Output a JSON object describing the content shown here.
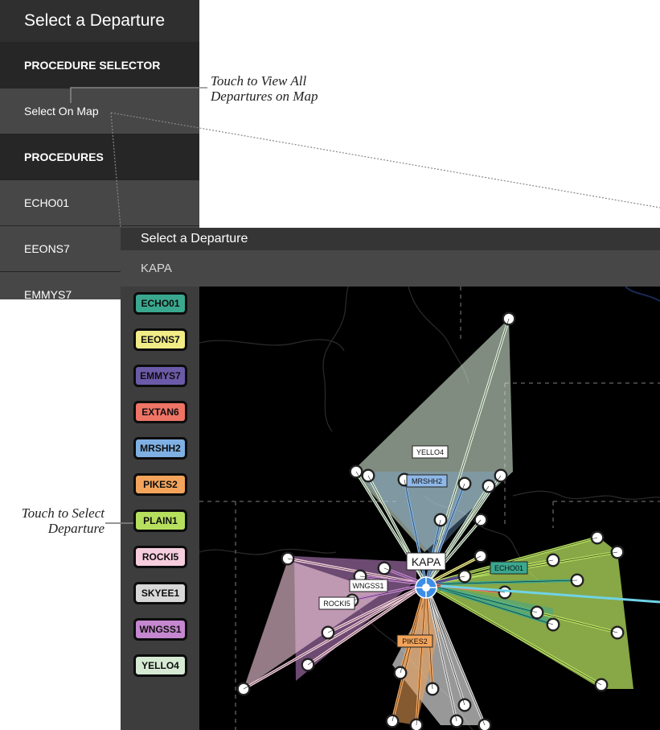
{
  "menu": {
    "title": "Select a Departure",
    "procedure_selector_header": "PROCEDURE SELECTOR",
    "select_on_map": "Select On Map",
    "procedures_header": "PROCEDURES",
    "items": [
      "ECHO01",
      "EEONS7",
      "EMMYS7"
    ]
  },
  "map_window": {
    "title": "Select a Departure",
    "airport": "KAPA",
    "procedures": [
      {
        "label": "ECHO01",
        "color": "#3aa88f"
      },
      {
        "label": "EEONS7",
        "color": "#f1ec86"
      },
      {
        "label": "EMMYS7",
        "color": "#6b5aa8"
      },
      {
        "label": "EXTAN6",
        "color": "#ee7466"
      },
      {
        "label": "MRSHH2",
        "color": "#7fb0e3"
      },
      {
        "label": "PIKES2",
        "color": "#f3a45a"
      },
      {
        "label": "PLAIN1",
        "color": "#b6df5e"
      },
      {
        "label": "ROCKI5",
        "color": "#f6cddd"
      },
      {
        "label": "SKYEE1",
        "color": "#d8d8d8"
      },
      {
        "label": "WNGSS1",
        "color": "#c587cf"
      },
      {
        "label": "YELLO4",
        "color": "#d6ead3"
      }
    ],
    "map_labels": {
      "airport": "KAPA",
      "yello4": "YELLO4",
      "mrshh2": "MRSHH2",
      "wngss1": "WNGSS1",
      "rocki5": "ROCKI5",
      "echo01": "ECHO01",
      "pikes2": "PIKES2"
    }
  },
  "callouts": {
    "view_all_line1": "Touch to View All",
    "view_all_line2": "Departures on Map",
    "select_line1": "Touch to Select",
    "select_line2": "Departure"
  }
}
